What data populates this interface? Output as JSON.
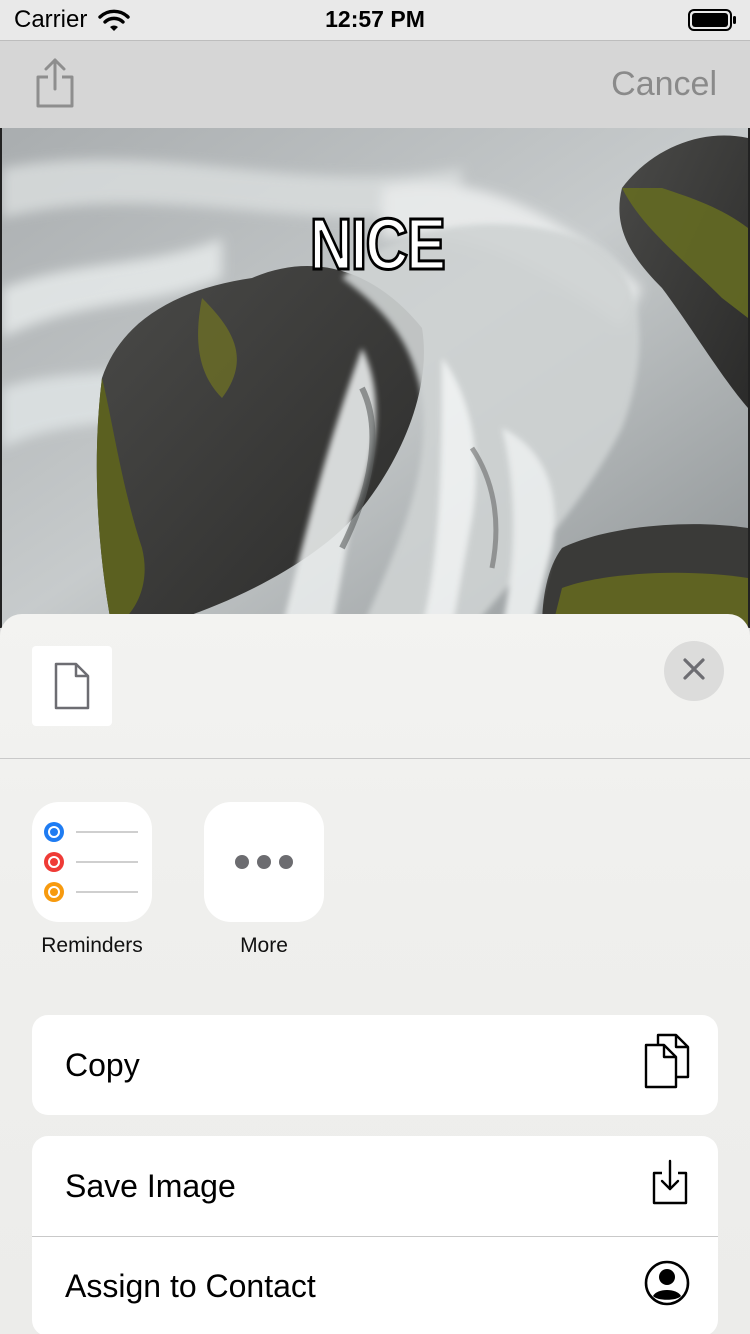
{
  "status_bar": {
    "carrier": "Carrier",
    "time": "12:57 PM",
    "wifi_icon": "wifi-icon",
    "battery_icon": "battery-icon"
  },
  "nav_bar": {
    "share_icon": "share-icon",
    "cancel_label": "Cancel"
  },
  "photo": {
    "meme_text": "NICE"
  },
  "share_sheet": {
    "header": {
      "doc_icon": "document-icon",
      "close_icon": "close-icon"
    },
    "apps": [
      {
        "label": "Reminders",
        "icon": "reminders-icon",
        "dot_colors": [
          "#1f7cf2",
          "#ef3b36",
          "#f79a0e"
        ]
      },
      {
        "label": "More",
        "icon": "more-icon"
      }
    ],
    "actions_group_1": [
      {
        "label": "Copy",
        "icon": "copy-icon"
      }
    ],
    "actions_group_2": [
      {
        "label": "Save Image",
        "icon": "save-image-icon"
      },
      {
        "label": "Assign to Contact",
        "icon": "contact-icon"
      }
    ]
  }
}
